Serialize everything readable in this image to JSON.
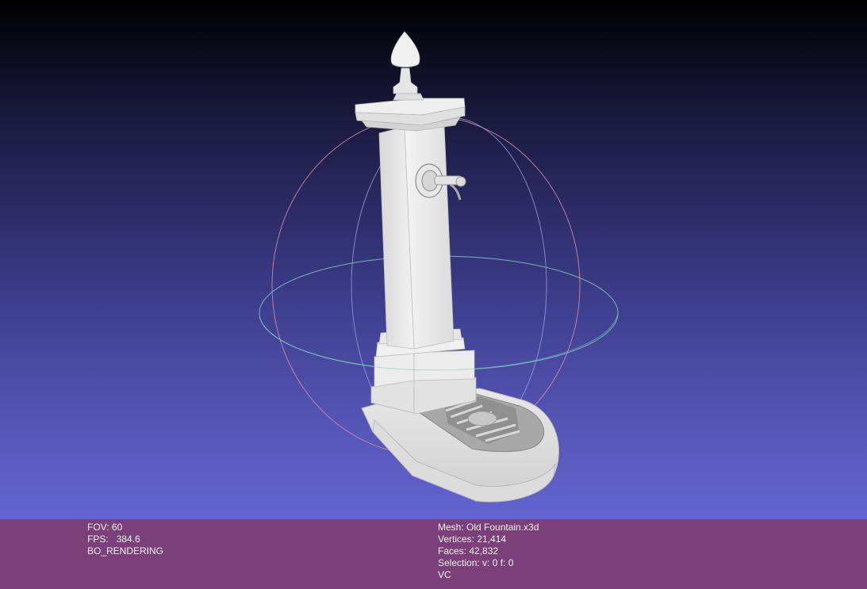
{
  "viewer": {
    "left_info": {
      "fov": "FOV: 60",
      "fps": "FPS:   384.6",
      "render_mode": "BO_RENDERING"
    },
    "right_info": {
      "mesh": "Mesh: Old Fountain.x3d",
      "vertices": "Vertices: 21,414",
      "faces": "Faces: 42,832",
      "selection": "Selection: v: 0 f: 0",
      "vc": "VC"
    }
  },
  "colors": {
    "info_bar": "#7b4079",
    "background_top": "#000000",
    "background_bottom": "#6464d0",
    "model": "#e6e6e6"
  }
}
